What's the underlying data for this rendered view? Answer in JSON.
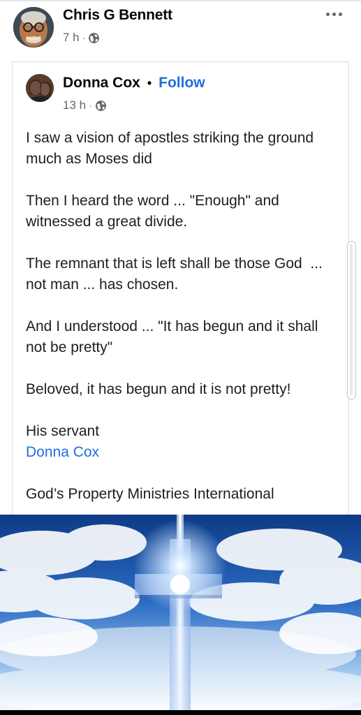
{
  "outer_post": {
    "author": "Chris G Bennett",
    "time": "7 h",
    "separator": "·",
    "privacy_icon": "globe-icon",
    "more_icon": "more-horizontal-icon"
  },
  "shared_post": {
    "author": "Donna Cox",
    "follow_separator": "•",
    "follow_label": "Follow",
    "time": "13 h",
    "separator": "·",
    "privacy_icon": "globe-icon",
    "paragraphs": [
      "I saw a vision of apostles striking the ground much as Moses did",
      "Then I heard the word ... \"Enough\" and witnessed a great divide.",
      "The remnant that is left shall be those God  ... not man ... has chosen.",
      "And I understood ... \"It has begun and it shall not be pretty\"",
      "Beloved, it has begun and it is not pretty!"
    ],
    "signature_line": "His servant",
    "signature_mention": "Donna Cox",
    "organization": "God’s Property Ministries International"
  },
  "image": {
    "subject": "glowing-cross-in-sky",
    "sky_color": "#1a4fa0",
    "cloud_color": "#ffffff",
    "cross_glow_color": "#e6f2ff"
  },
  "colors": {
    "link": "#216fdb",
    "secondary_text": "#65676b",
    "primary_text": "#050505"
  }
}
